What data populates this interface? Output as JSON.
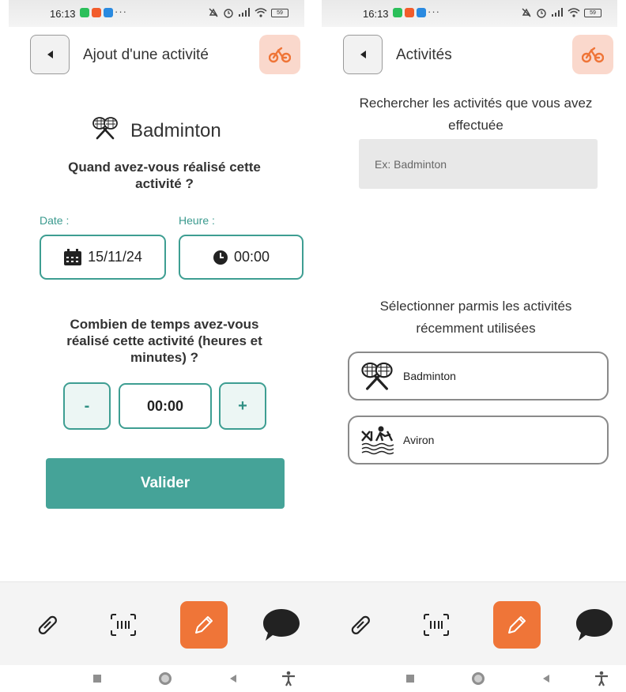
{
  "status_bar": {
    "time": "16:13",
    "more": "···",
    "battery": "59"
  },
  "colors": {
    "accent": "#45a398",
    "orange": "#ef7538",
    "bike_bg": "#fad8cc"
  },
  "left": {
    "header": {
      "title": "Ajout d'une activité",
      "back_icon": "chevron-left-icon",
      "right_icon": "bicycle-icon"
    },
    "sport_name": "Badminton",
    "question_when": "Quand avez-vous réalisé cette activité ?",
    "date_label": "Date :",
    "date_value": "15/11/24",
    "time_label": "Heure :",
    "time_value": "00:00",
    "question_duration": "Combien de temps avez-vous réalisé cette activité (heures et minutes) ?",
    "minus_label": "-",
    "duration_value": "00:00",
    "plus_label": "+",
    "submit_label": "Valider"
  },
  "right": {
    "header": {
      "title": "Activités",
      "back_icon": "chevron-left-icon",
      "right_icon": "bicycle-icon"
    },
    "search_intro": "Rechercher les activités que vous avez effectuée",
    "search_placeholder": "Ex: Badminton",
    "recent_intro": "Sélectionner parmis les activités récemment utilisées",
    "recent_activities": [
      {
        "label": "Badminton",
        "icon": "badminton-icon"
      },
      {
        "label": "Aviron",
        "icon": "rowing-icon"
      }
    ]
  },
  "bottom_nav": [
    "link-icon",
    "scan-icon",
    "pencil-icon",
    "chat-bubble-icon"
  ]
}
